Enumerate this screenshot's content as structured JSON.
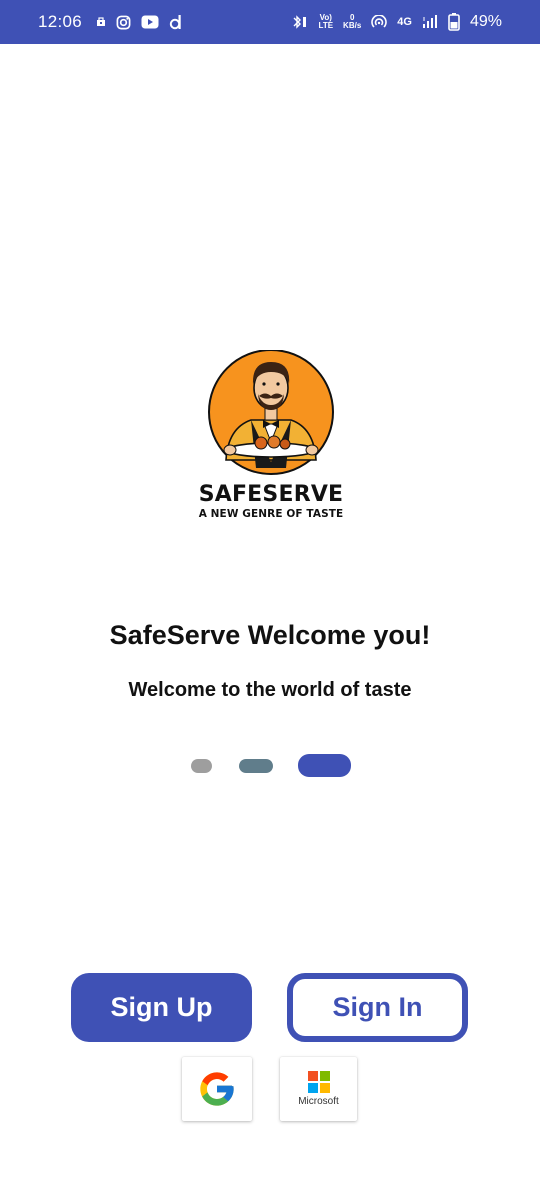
{
  "status_bar": {
    "time": "12:06",
    "volte_label_top": "Vo)",
    "volte_label_bottom": "LTE",
    "speed_value": "0",
    "speed_unit": "KB/s",
    "network": "4G",
    "battery": "49%",
    "background_color": "#3f51b5"
  },
  "brand": {
    "name": "SAFESERVE",
    "tagline": "A NEW GENRE OF TASTE",
    "logo_circle_color": "#f7931e"
  },
  "welcome": {
    "title": "SafeServe Welcome you!",
    "subtitle": "Welcome to the world of taste"
  },
  "pager": {
    "pages": 3,
    "active_index": 2,
    "colors": [
      "#9e9e9e",
      "#607d8b",
      "#3f51b5"
    ]
  },
  "actions": {
    "signup_label": "Sign Up",
    "signin_label": "Sign In",
    "accent_color": "#3f51b5"
  },
  "social": {
    "google_icon": "google-icon",
    "microsoft_icon": "microsoft-icon",
    "microsoft_label": "Microsoft"
  }
}
